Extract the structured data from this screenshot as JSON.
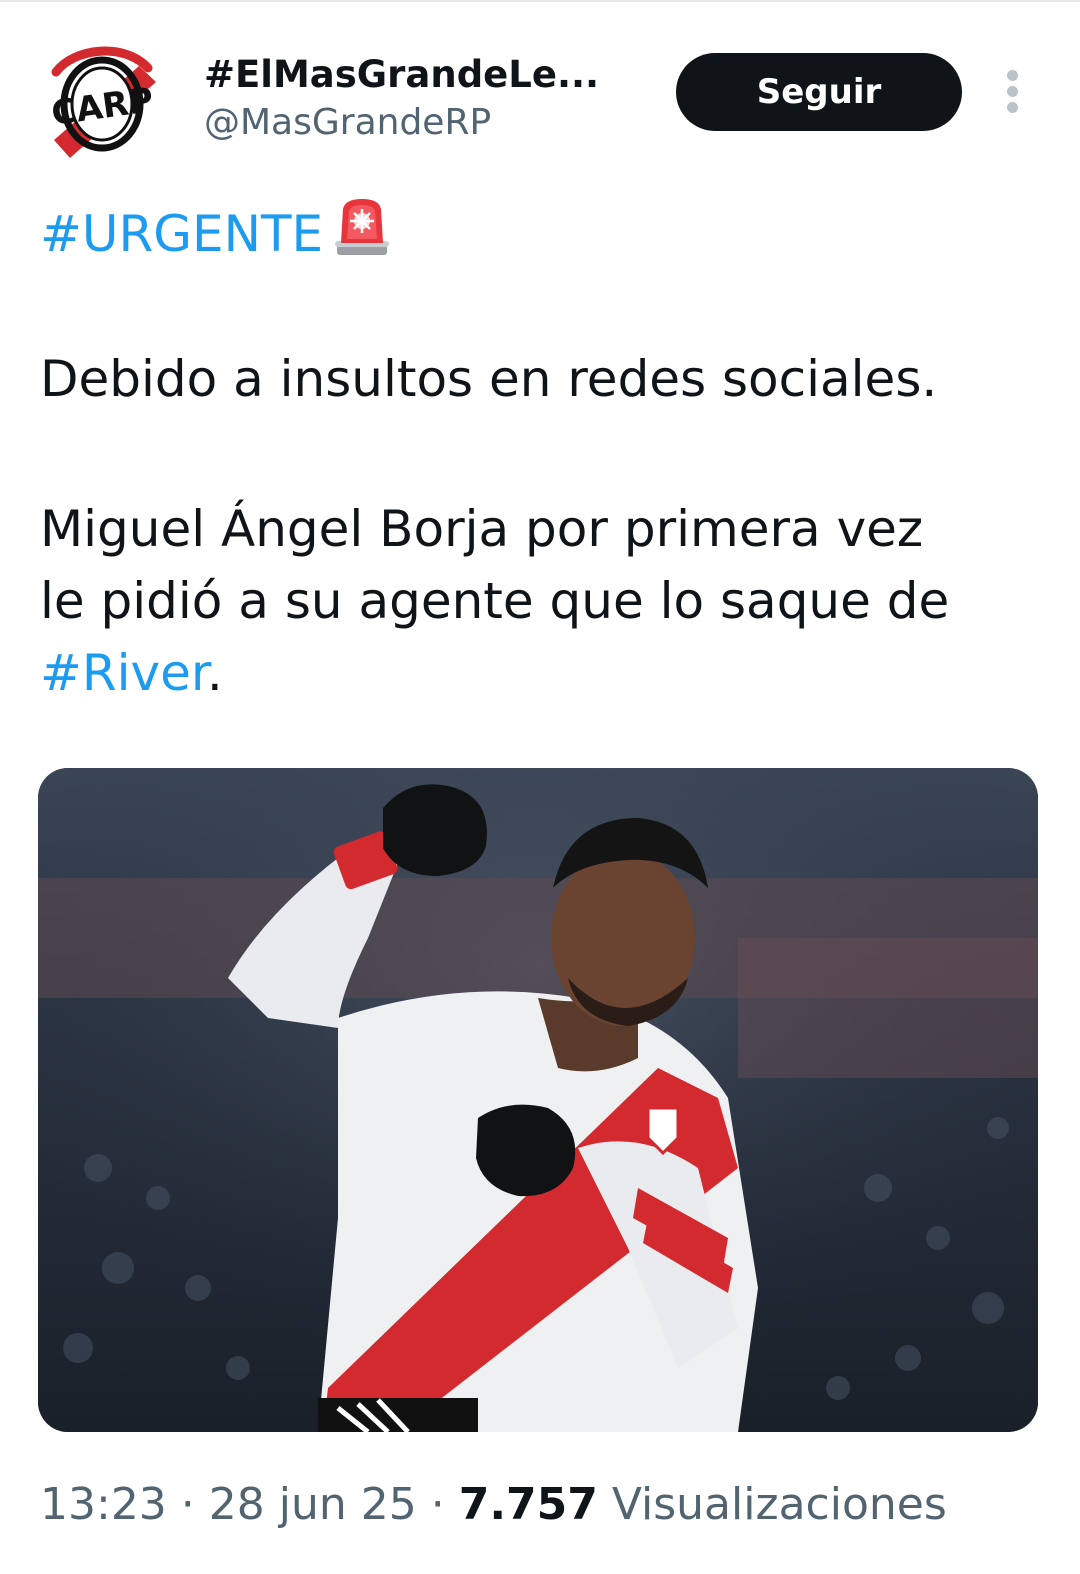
{
  "header": {
    "display_name": "#ElMasGrandeLe...",
    "handle": "@MasGrandeRP",
    "follow_label": "Seguir",
    "avatar_icon": "river-plate-crest-icon",
    "more_icon": "more-vertical-icon"
  },
  "tweet": {
    "hashtag_urgent": "#URGENTE",
    "urgent_icon": "police-siren-icon",
    "paragraph_1": "Debido a insultos en redes sociales.",
    "paragraph_2_line_1": "Miguel Ángel Borja por primera vez",
    "paragraph_2_line_2": "le pidió a su agente que lo saque de",
    "hashtag_river": "#River",
    "trailing_period": "."
  },
  "media": {
    "photo_icon": "footballer-celebrating-photo"
  },
  "meta": {
    "time": "13:23",
    "separator": " · ",
    "date": "28 jun 25",
    "views_count": "7.757",
    "views_label": "Visualizaciones"
  },
  "colors": {
    "link": "#1d9bf0",
    "text": "#0f1419",
    "secondary": "#536471",
    "button_bg": "#0f1419",
    "river_red": "#d22a2f"
  }
}
